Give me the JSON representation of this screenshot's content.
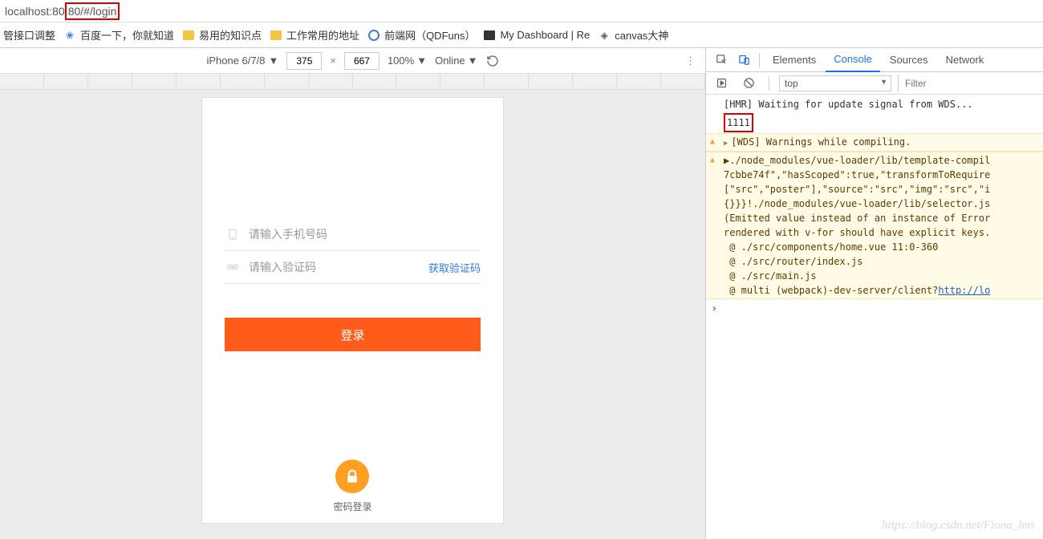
{
  "address": {
    "prefix": "localhost:80",
    "highlighted": "80/#/login"
  },
  "bookmarks": [
    {
      "label": "管接口调整",
      "icon": ""
    },
    {
      "label": "百度一下，你就知道",
      "icon": "paw"
    },
    {
      "label": "易用的知识点",
      "icon": "folder"
    },
    {
      "label": "工作常用的地址",
      "icon": "folder"
    },
    {
      "label": "前端网（QDFuns）",
      "icon": "circle"
    },
    {
      "label": "My Dashboard | Re",
      "icon": "dark"
    },
    {
      "label": "canvas大神",
      "icon": "cube"
    }
  ],
  "device_toolbar": {
    "device": "iPhone 6/7/8",
    "width": "375",
    "height": "667",
    "zoom": "100%",
    "network": "Online"
  },
  "login": {
    "phone_placeholder": "请输入手机号码",
    "code_placeholder": "请输入验证码",
    "get_code": "获取验证码",
    "submit": "登录",
    "pwd_login": "密码登录"
  },
  "devtools": {
    "tabs": [
      "Elements",
      "Console",
      "Sources",
      "Network"
    ],
    "active_tab": "Console",
    "context": "top",
    "filter_placeholder": "Filter",
    "logs": [
      {
        "type": "plain",
        "text": "[HMR] Waiting for update signal from WDS..."
      },
      {
        "type": "plain-boxed",
        "text": "1111"
      },
      {
        "type": "warn-expand",
        "text": "[WDS] Warnings while compiling."
      },
      {
        "type": "warn-block",
        "lines": [
          "▶./node_modules/vue-loader/lib/template-compil",
          "7cbbe74f\",\"hasScoped\":true,\"transformToRequire",
          "[\"src\",\"poster\"],\"source\":\"src\",\"img\":\"src\",\"i",
          "{}}}!./node_modules/vue-loader/lib/selector.js",
          "(Emitted value instead of an instance of Error",
          "rendered with v-for should have explicit keys.",
          " @ ./src/components/home.vue 11:0-360",
          " @ ./src/router/index.js",
          " @ ./src/main.js",
          " @ multi (webpack)-dev-server/client?http://lo"
        ]
      }
    ]
  },
  "watermark": "https://blog.csdn.net/Fiona_lms"
}
